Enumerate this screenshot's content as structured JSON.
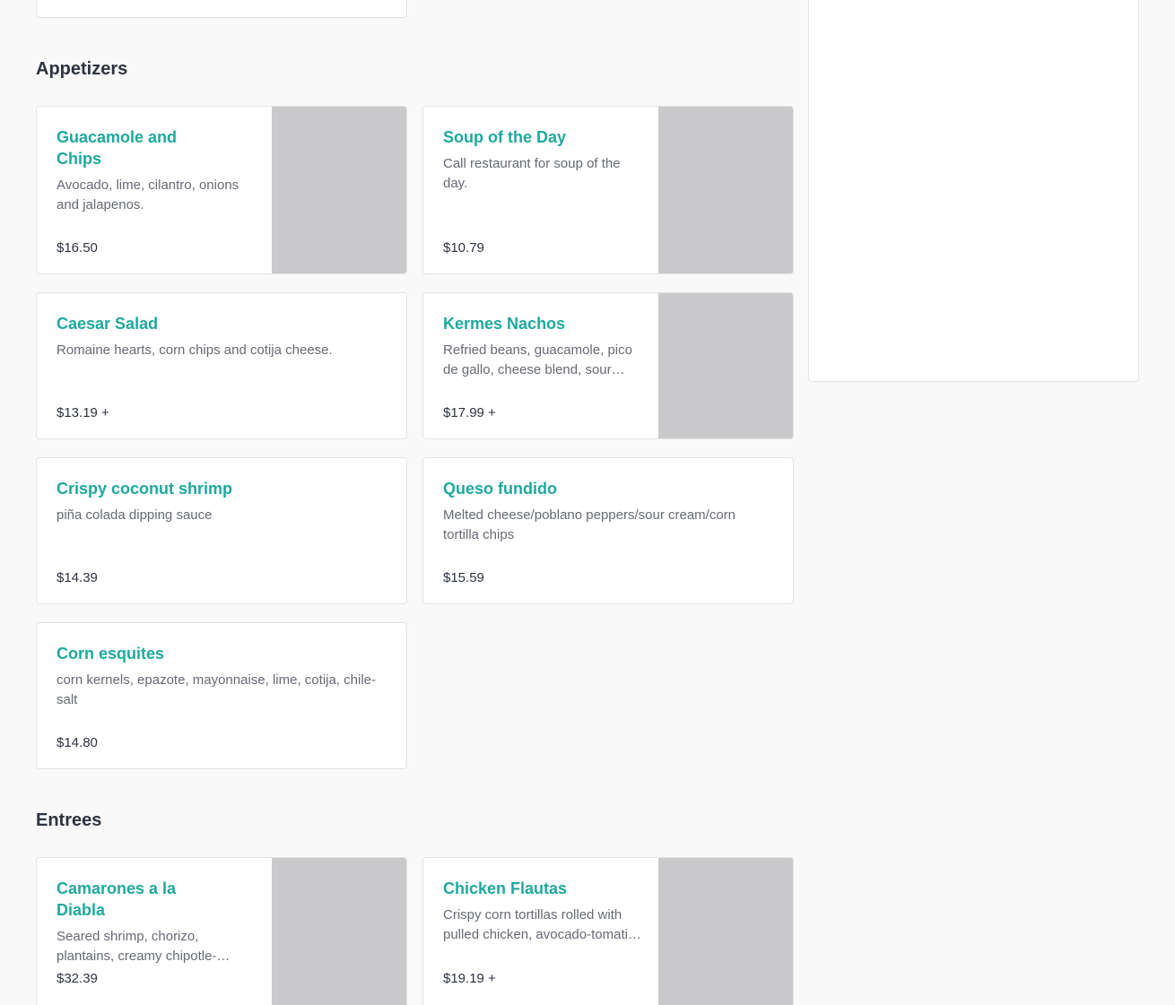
{
  "sections": [
    {
      "title": "Appetizers",
      "items": [
        {
          "name": "Guacamole and Chips",
          "description": "Avocado, lime, cilantro, onions and jalapenos.",
          "price": "$16.50"
        },
        {
          "name": "Soup of the Day",
          "description": "Call restaurant for soup of the day.",
          "price": "$10.79"
        },
        {
          "name": "Caesar Salad",
          "description": "Romaine hearts, corn chips and cotija cheese.",
          "price": "$13.19 +"
        },
        {
          "name": "Kermes Nachos",
          "description": "Refried beans, guacamole, pico de gallo, cheese blend, sour cream.",
          "price": "$17.99 +"
        },
        {
          "name": "Crispy coconut shrimp",
          "description": "piña colada dipping sauce",
          "price": "$14.39"
        },
        {
          "name": "Queso fundido",
          "description": "Melted cheese/poblano peppers/sour cream/corn tortilla chips",
          "price": "$15.59"
        },
        {
          "name": "Corn esquites",
          "description": "corn kernels, epazote, mayonnaise, lime, cotija, chile-salt",
          "price": "$14.80"
        }
      ]
    },
    {
      "title": "Entrees",
      "items": [
        {
          "name": "Camarones a la Diabla",
          "description": "Seared shrimp, chorizo, plantains, creamy chipotle-tomato sauce.",
          "price": "$32.39"
        },
        {
          "name": "Chicken Flautas",
          "description": "Crispy corn tortillas rolled with pulled chicken, avocado-tomatillo salsa.",
          "price": "$19.19 +"
        }
      ]
    }
  ]
}
